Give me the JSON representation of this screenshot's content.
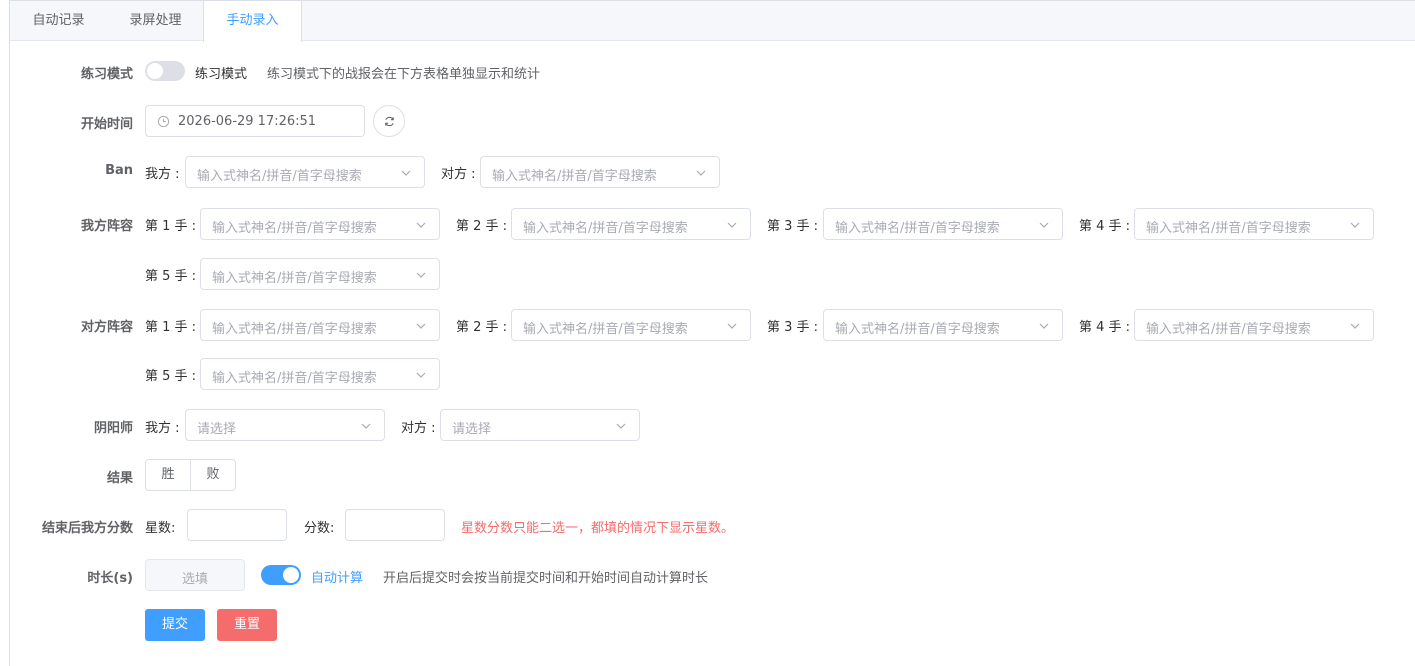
{
  "tabs": [
    "自动记录",
    "录屏处理",
    "手动录入"
  ],
  "practice": {
    "label": "练习模式",
    "toggle_text": "练习模式",
    "hint": "练习模式下的战报会在下方表格单独显示和统计"
  },
  "start_time": {
    "label": "开始时间",
    "value": "2026-06-29 17:26:51"
  },
  "ban": {
    "label": "Ban",
    "ours": "我方 :",
    "theirs": "对方 :"
  },
  "select_placeholder": "输入式神名/拼音/首字母搜索",
  "our_lineup": {
    "label": "我方阵容"
  },
  "their_lineup": {
    "label": "对方阵容"
  },
  "picks": [
    "第 1 手 :",
    "第 2 手 :",
    "第 3 手 :",
    "第 4 手 :",
    "第 5 手 :"
  ],
  "onmyoji": {
    "label": "阴阳师",
    "ours": "我方 :",
    "theirs": "对方 :",
    "placeholder": "请选择"
  },
  "result": {
    "label": "结果",
    "win": "胜",
    "lose": "败"
  },
  "score": {
    "label": "结束后我方分数",
    "stars": "星数:",
    "points": "分数:",
    "warning": "星数分数只能二选一，都填的情况下显示星数。"
  },
  "duration": {
    "label": "时长(s)",
    "placeholder": "选填",
    "auto_label": "自动计算",
    "hint": "开启后提交时会按当前提交时间和开始时间自动计算时长"
  },
  "actions": {
    "submit": "提交",
    "reset": "重置"
  },
  "colors": {
    "primary": "#409eff",
    "danger": "#f56c6c",
    "warning_text": "#f56c6c"
  }
}
